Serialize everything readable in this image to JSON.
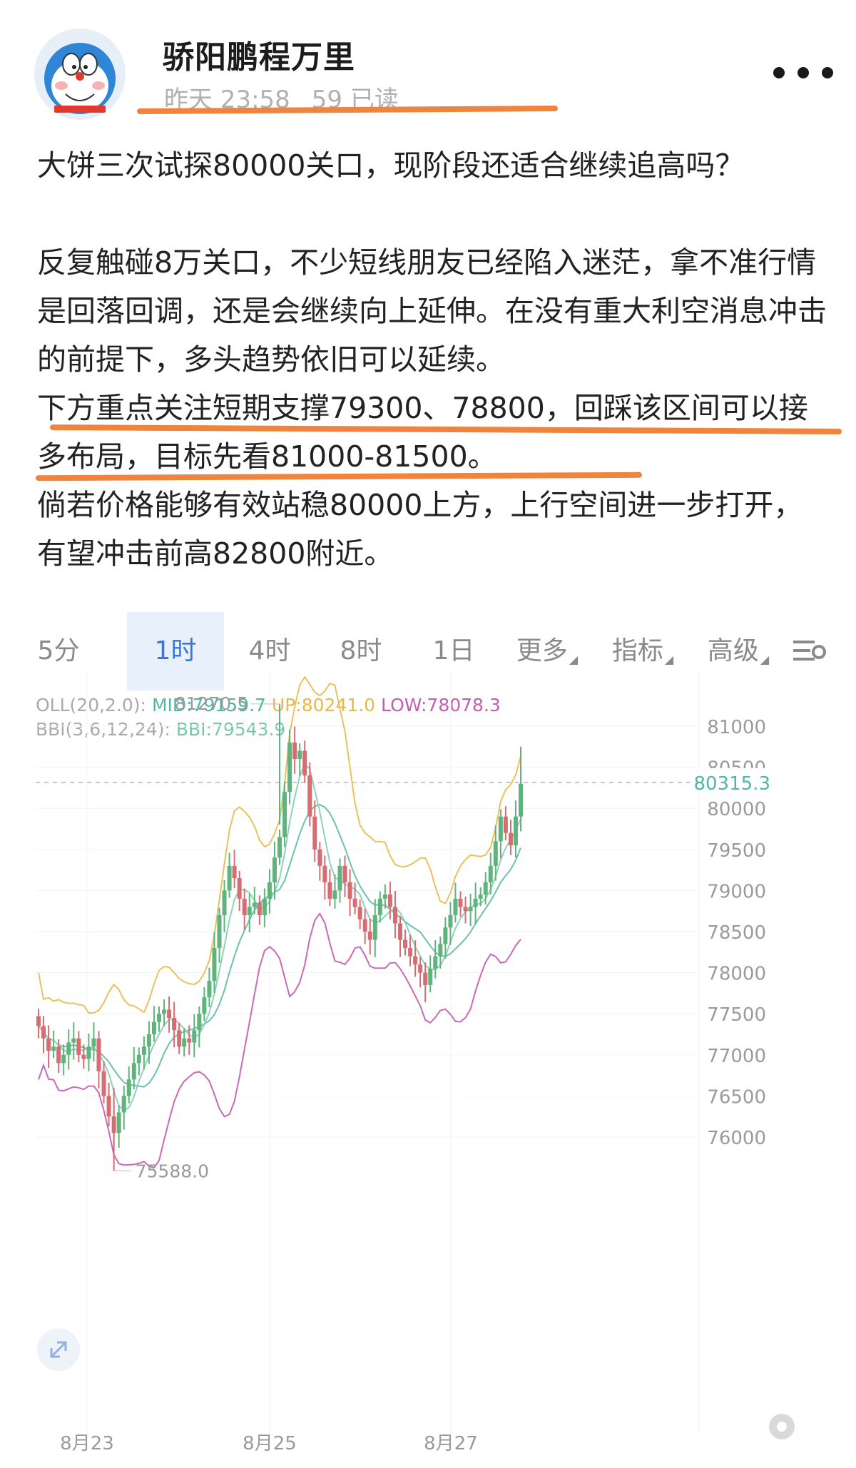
{
  "post": {
    "author": "骄阳鹏程万里",
    "time": "昨天 23:58",
    "reads": "59 已读",
    "paragraphs": [
      "大饼三次试探80000关口，现阶段还适合继续追高吗？",
      "反复触碰8万关口，不少短线朋友已经陷入迷茫，拿不准行情是回落回调，还是会继续向上延伸。在没有重大利空消息冲击的前提下，多头趋势依旧可以延续。",
      "下方重点关注短期支撑79300、78800，回踩该区间可以接多布局，目标先看81000-81500。",
      "倘若价格能够有效站稳80000上方，上行空间进一步打开，有望冲击前高82800附近。"
    ]
  },
  "chart": {
    "tabs": [
      {
        "label": "5分",
        "active": false
      },
      {
        "label": "1时",
        "active": true
      },
      {
        "label": "4时",
        "active": false
      },
      {
        "label": "8时",
        "active": false
      },
      {
        "label": "1日",
        "active": false
      },
      {
        "label": "更多",
        "active": false
      },
      {
        "label": "指标",
        "active": false
      },
      {
        "label": "高级",
        "active": false
      }
    ],
    "indicator_line1": {
      "name": "OLL(20,2.0):",
      "mid": "MID:79159.7",
      "up": "UP:80241.0",
      "low": "LOW:78078.3"
    },
    "indicator_line2": {
      "name": "BBI(3,6,12,24):",
      "bbi": "BBI:79543.9"
    },
    "high_label": "81270.5",
    "low_label": "75588.0",
    "current_price": "80315.3",
    "y_ticks": [
      "81000",
      "80500",
      "80000",
      "79500",
      "79000",
      "78500",
      "78000",
      "77500",
      "77000",
      "76500",
      "76000"
    ],
    "x_ticks": [
      "8月23",
      "8月25",
      "8月27"
    ],
    "colors": {
      "up": "#5fb37c",
      "down": "#d56d73",
      "boll_upper": "#e8c25a",
      "boll_mid": "#6cc0ae",
      "boll_lower": "#c86ab9",
      "bbi": "#8cd3b8",
      "active_tab": "#3a78d8"
    }
  },
  "chart_data": {
    "type": "candlestick",
    "ylim": [
      75500,
      81500
    ],
    "current_price": 80315.3,
    "high": 81270.5,
    "low": 75588.0,
    "indicators": {
      "boll_mid": 79159.7,
      "boll_up": 80241.0,
      "boll_low": 78078.3,
      "bbi": 79543.9
    },
    "closes": [
      77350,
      77200,
      77050,
      77100,
      76900,
      77000,
      77150,
      77200,
      77000,
      76950,
      77100,
      77200,
      76800,
      76500,
      76250,
      76050,
      76300,
      76500,
      76700,
      76900,
      77000,
      77100,
      77250,
      77400,
      77500,
      77550,
      77450,
      77300,
      77100,
      77200,
      77150,
      77300,
      77500,
      77700,
      77900,
      78300,
      78700,
      79000,
      79300,
      79150,
      78900,
      78700,
      78800,
      78850,
      78700,
      78900,
      79100,
      79400,
      79650,
      80200,
      80800,
      80600,
      80700,
      80400,
      79900,
      79500,
      79300,
      79100,
      78900,
      79000,
      79300,
      79100,
      78900,
      78800,
      78650,
      78500,
      78400,
      78700,
      78900,
      78950,
      78800,
      78600,
      78400,
      78300,
      78200,
      78100,
      78000,
      77850,
      78050,
      78200,
      78350,
      78550,
      78700,
      78900,
      78800,
      78750,
      78800,
      78900,
      78950,
      79100,
      79300,
      79600,
      79900,
      79700,
      79550,
      79900,
      80300
    ]
  }
}
